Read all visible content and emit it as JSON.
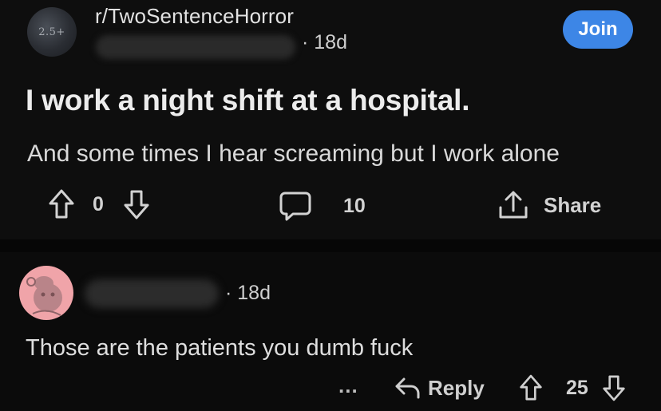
{
  "post": {
    "subreddit": "r/TwoSentenceHorror",
    "subreddit_avatar_text": "2.5+",
    "age": "· 18d",
    "join_label": "Join",
    "title": "I work a night shift at a hospital.",
    "body": "And some times I hear screaming but I work alone",
    "votes": "0",
    "comments": "10",
    "share_label": "Share"
  },
  "comment": {
    "age": "· 18d",
    "text": "Those are the patients you dumb fuck",
    "more_label": "...",
    "reply_label": "Reply",
    "votes": "25"
  },
  "colors": {
    "background": "#0b0b0b",
    "join_button": "#3d86e6",
    "comment_avatar": "#f0a4a9"
  },
  "icons": [
    "upvote-icon",
    "downvote-icon",
    "comment-icon",
    "share-icon",
    "reply-icon",
    "more-icon",
    "snoo-avatar-icon"
  ]
}
